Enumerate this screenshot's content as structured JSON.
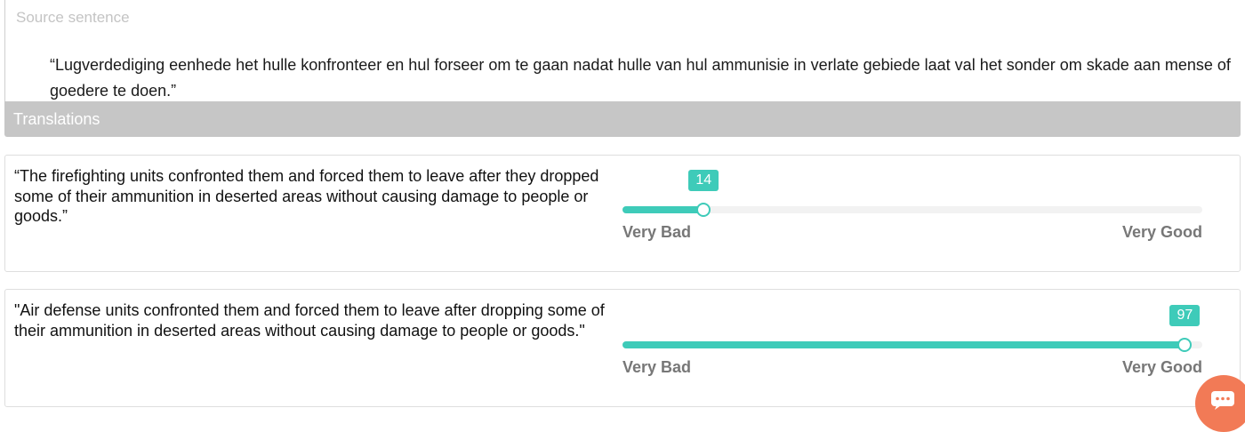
{
  "source": {
    "label": "Source sentence",
    "text": "“Lugverdediging eenhede het hulle konfronteer en hul forseer om te gaan nadat hulle van hul ammunisie in verlate gebiede laat val het sonder om skade aan mense of goedere te doen.”"
  },
  "translations": {
    "header": "Translations",
    "items": [
      {
        "text": "“The firefighting units confronted them and forced them to leave after they dropped some of their ammunition in deserted areas without causing damage to people or goods.”",
        "score": 14,
        "min_label": "Very Bad",
        "max_label": "Very Good"
      },
      {
        "text": "\"Air defense units confronted them and forced them to leave after dropping some of their ammunition in deserted areas without causing damage to people or goods.\"",
        "score": 97,
        "min_label": "Very Bad",
        "max_label": "Very Good"
      }
    ]
  },
  "slider_range": {
    "min": 0,
    "max": 100
  },
  "colors": {
    "accent": "#3ecbb9",
    "chat": "#f27a56"
  },
  "icons": {
    "chat": "chat-bubble-icon"
  }
}
